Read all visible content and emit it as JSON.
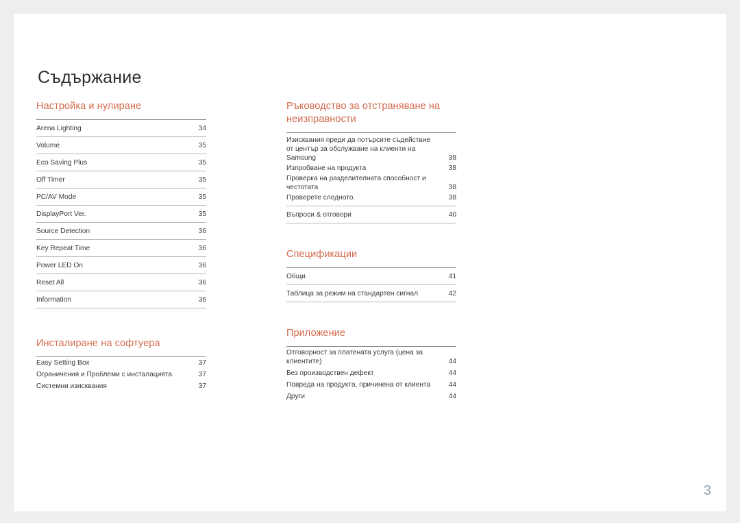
{
  "document": {
    "title": "Съдържание",
    "page_number": "3",
    "accent_color": "#d2694b",
    "page_number_color": "#92a1ae"
  },
  "left_column": [
    {
      "title": "Настройка и нулиране",
      "style": "ruled",
      "entries": [
        {
          "label": "Arena Lighting",
          "page": "34"
        },
        {
          "label": "Volume",
          "page": "35"
        },
        {
          "label": "Eco Saving Plus",
          "page": "35"
        },
        {
          "label": "Off Timer",
          "page": "35"
        },
        {
          "label": "PC/AV Mode",
          "page": "35"
        },
        {
          "label": "DisplayPort Ver.",
          "page": "35"
        },
        {
          "label": "Source Detection",
          "page": "36"
        },
        {
          "label": "Key Repeat Time",
          "page": "36"
        },
        {
          "label": "Power LED On",
          "page": "36"
        },
        {
          "label": "Reset All",
          "page": "36"
        },
        {
          "label": "Information",
          "page": "36"
        }
      ]
    },
    {
      "title": "Инсталиране на софтуера",
      "style": "compact",
      "entries": [
        {
          "label": "Easy Setting Box",
          "page": "37"
        },
        {
          "label": "Ограничения и Проблеми с инсталацията",
          "page": "37"
        },
        {
          "label": "Системни изисквания",
          "page": "37"
        }
      ]
    }
  ],
  "right_column": [
    {
      "title": "Ръководство за отстраняване\nна неизправности",
      "style": "group",
      "entries": [
        {
          "label": "Изисквания преди да потърсите съдействие\nот център за обслужване на клиенти на\nSamsung",
          "page": "38"
        },
        {
          "label": "Изпробване на продукта",
          "page": "38"
        },
        {
          "label": "Проверка на разделителната способност и\nчестотата",
          "page": "38"
        },
        {
          "label": "Проверете следното.",
          "page": "38"
        }
      ],
      "tail_entries": [
        {
          "label": "Въпроси & отговори",
          "page": "40"
        }
      ]
    },
    {
      "title": "Спецификации",
      "style": "ruled",
      "entries": [
        {
          "label": "Общи",
          "page": "41"
        },
        {
          "label": "Таблица за режим на стандартен сигнал",
          "page": "42"
        }
      ]
    },
    {
      "title": "Приложение",
      "style": "compact-top",
      "entries": [
        {
          "label": "Отговорност за платената услуга (цена за\nклиентите)",
          "page": "44"
        },
        {
          "label": "Без производствен дефект",
          "page": "44"
        },
        {
          "label": "Повреда на продукта, причинена от клиента",
          "page": "44"
        },
        {
          "label": "Други",
          "page": "44"
        }
      ]
    }
  ]
}
